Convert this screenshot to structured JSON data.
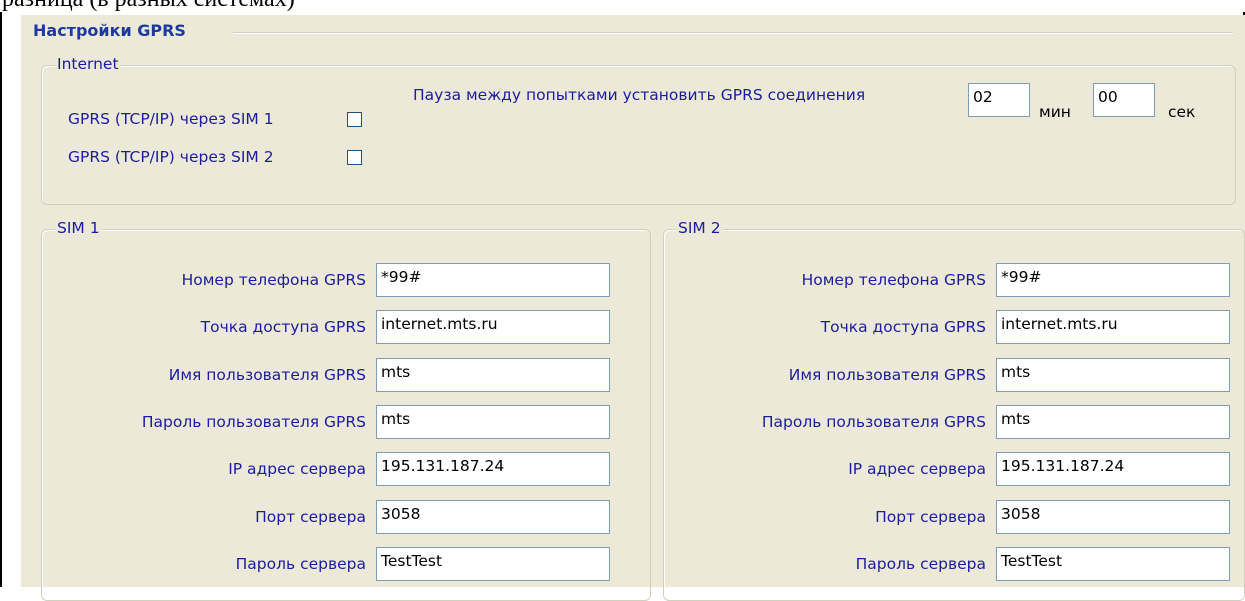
{
  "document": {
    "top_text": "разница (в разных системах)"
  },
  "title": "Настройки GPRS",
  "internet": {
    "title": "Internet",
    "sim1_checkbox_label": "GPRS (TCP/IP) через SIM 1",
    "sim2_checkbox_label": "GPRS (TCP/IP) через SIM 2",
    "sim1_checked": false,
    "sim2_checked": false,
    "pause_label": "Пауза между попытками установить GPRS соединения",
    "pause_minutes": "02",
    "minutes_unit": "мин",
    "pause_seconds": "00",
    "seconds_unit": "сек"
  },
  "sim1": {
    "title": "SIM 1",
    "fields": [
      {
        "label": "Номер телефона GPRS",
        "value": "*99#"
      },
      {
        "label": "Точка доступа GPRS",
        "value": "internet.mts.ru"
      },
      {
        "label": "Имя пользователя GPRS",
        "value": "mts"
      },
      {
        "label": "Пароль пользователя GPRS",
        "value": "mts"
      },
      {
        "label": "IP адрес сервера",
        "value": "195.131.187.24"
      },
      {
        "label": "Порт сервера",
        "value": "3058"
      },
      {
        "label": "Пароль сервера",
        "value": "TestTest"
      }
    ]
  },
  "sim2": {
    "title": "SIM 2",
    "fields": [
      {
        "label": "Номер телефона GPRS",
        "value": "*99#"
      },
      {
        "label": "Точка доступа GPRS",
        "value": "internet.mts.ru"
      },
      {
        "label": "Имя пользователя GPRS",
        "value": "mts"
      },
      {
        "label": "Пароль пользователя GPRS",
        "value": "mts"
      },
      {
        "label": "IP адрес сервера",
        "value": "195.131.187.24"
      },
      {
        "label": "Порт сервера",
        "value": "3058"
      },
      {
        "label": "Пароль сервера",
        "value": "TestTest"
      }
    ]
  },
  "colors": {
    "panel_background": "#ece9d8",
    "label_text": "#1c1ca0",
    "title_text": "#1c3a9e",
    "group_border": "#d0d0bf",
    "input_border": "#7f9db9"
  }
}
